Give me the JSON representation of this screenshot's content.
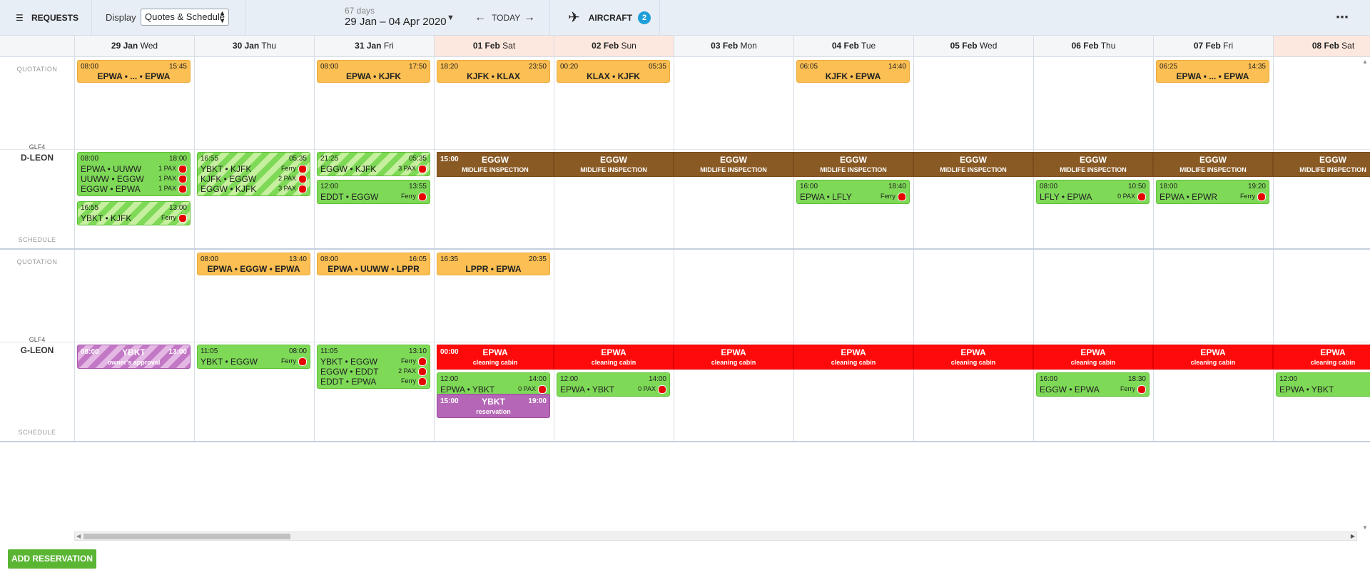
{
  "toolbar": {
    "requests_label": "REQUESTS",
    "display_label": "Display",
    "display_value": "Quotes & Schedule",
    "range_days": "67 days",
    "range_text": "29 Jan – 04 Apr 2020",
    "today_label": "TODAY",
    "aircraft_label": "AIRCRAFT",
    "aircraft_count": "2"
  },
  "days": [
    {
      "date": "29 Jan",
      "dow": "Wed",
      "weekend": false
    },
    {
      "date": "30 Jan",
      "dow": "Thu",
      "weekend": false
    },
    {
      "date": "31 Jan",
      "dow": "Fri",
      "weekend": false
    },
    {
      "date": "01 Feb",
      "dow": "Sat",
      "weekend": true
    },
    {
      "date": "02 Feb",
      "dow": "Sun",
      "weekend": true
    },
    {
      "date": "03 Feb",
      "dow": "Mon",
      "weekend": false
    },
    {
      "date": "04 Feb",
      "dow": "Tue",
      "weekend": false
    },
    {
      "date": "05 Feb",
      "dow": "Wed",
      "weekend": false
    },
    {
      "date": "06 Feb",
      "dow": "Thu",
      "weekend": false
    },
    {
      "date": "07 Feb",
      "dow": "Fri",
      "weekend": false
    },
    {
      "date": "08 Feb",
      "dow": "Sat",
      "weekend": true
    }
  ],
  "row_labels": {
    "quotation": "QUOTATION",
    "schedule": "SCHEDULE"
  },
  "aircraft": [
    {
      "type": "GLF4",
      "reg": "D-LEON",
      "quotes": [
        {
          "day": 0,
          "start": "08:00",
          "end": "15:45",
          "route": "EPWA • ... • EPWA"
        },
        {
          "day": 2,
          "start": "08:00",
          "end": "17:50",
          "route": "EPWA • KJFK"
        },
        {
          "day": 3,
          "start": "18:20",
          "end": "23:50",
          "route": "KJFK • KLAX"
        },
        {
          "day": 4,
          "start": "00:20",
          "end": "05:35",
          "route": "KLAX • KJFK"
        },
        {
          "day": 6,
          "start": "06:05",
          "end": "14:40",
          "route": "KJFK • EPWA"
        },
        {
          "day": 9,
          "start": "06:25",
          "end": "14:35",
          "route": "EPWA • ... • EPWA"
        }
      ],
      "flights": [
        {
          "day": 0,
          "slot": 0,
          "style": "s",
          "start": "08:00",
          "end": "18:00",
          "legs": [
            {
              "route": "EPWA • UUWW",
              "meta": "1 PAX"
            },
            {
              "route": "UUWW • EGGW",
              "meta": "1 PAX"
            },
            {
              "route": "EGGW • EPWA",
              "meta": "1 PAX"
            }
          ]
        },
        {
          "day": 0,
          "slot": 2,
          "style": "hatch",
          "start": "16:55",
          "end": "13:00",
          "legs": [
            {
              "route": "YBKT • KJFK",
              "meta": "Ferry"
            }
          ]
        },
        {
          "day": 1,
          "slot": 0,
          "style": "hatch",
          "start": "16:55",
          "end": "05:35",
          "legs": [
            {
              "route": "YBKT • KJFK",
              "meta": "Ferry"
            },
            {
              "route": "KJFK • EGGW",
              "meta": "2 PAX"
            },
            {
              "route": "EGGW • KJFK",
              "meta": "3 PAX"
            }
          ]
        },
        {
          "day": 2,
          "slot": 0,
          "style": "hatch",
          "start": "21:25",
          "end": "05:35",
          "legs": [
            {
              "route": "EGGW • KJFK",
              "meta": "3 PAX"
            }
          ]
        },
        {
          "day": 2,
          "slot": 1,
          "style": "s",
          "start": "12:00",
          "end": "13:55",
          "legs": [
            {
              "route": "EDDT • EGGW",
              "meta": "Ferry"
            }
          ]
        },
        {
          "day": 6,
          "slot": 1,
          "style": "s",
          "start": "16:00",
          "end": "18:40",
          "legs": [
            {
              "route": "EPWA • LFLY",
              "meta": "Ferry"
            }
          ]
        },
        {
          "day": 8,
          "slot": 1,
          "style": "s",
          "start": "08:00",
          "end": "10:50",
          "legs": [
            {
              "route": "LFLY • EPWA",
              "meta": "0 PAX"
            }
          ]
        },
        {
          "day": 9,
          "slot": 1,
          "style": "s",
          "start": "18:00",
          "end": "19:20",
          "legs": [
            {
              "route": "EPWA • EPWR",
              "meta": "Ferry"
            }
          ]
        }
      ],
      "blocks": [
        {
          "from": 3,
          "to": 10,
          "style": "brown",
          "start": "15:00",
          "title": "EGGW",
          "sub": "MIDLIFE INSPECTION"
        }
      ],
      "reservations": []
    },
    {
      "type": "GLF4",
      "reg": "G-LEON",
      "quotes": [
        {
          "day": 1,
          "start": "08:00",
          "end": "13:40",
          "route": "EPWA • EGGW • EPWA"
        },
        {
          "day": 2,
          "start": "08:00",
          "end": "16:05",
          "route": "EPWA • UUWW • LPPR"
        },
        {
          "day": 3,
          "start": "16:35",
          "end": "20:35",
          "route": "LPPR • EPWA"
        }
      ],
      "flights": [
        {
          "day": 1,
          "slot": 0,
          "style": "s",
          "start": "11:05",
          "end": "08:00",
          "legs": [
            {
              "route": "YBKT • EGGW",
              "meta": "Ferry"
            }
          ]
        },
        {
          "day": 2,
          "slot": 0,
          "style": "s",
          "start": "11:05",
          "end": "13:10",
          "legs": [
            {
              "route": "YBKT • EGGW",
              "meta": "Ferry"
            },
            {
              "route": "EGGW • EDDT",
              "meta": "2 PAX"
            },
            {
              "route": "EDDT • EPWA",
              "meta": "Ferry"
            }
          ]
        },
        {
          "day": 3,
          "slot": 1,
          "style": "s",
          "start": "12:00",
          "end": "14:00",
          "legs": [
            {
              "route": "EPWA • YBKT",
              "meta": "0 PAX"
            }
          ]
        },
        {
          "day": 4,
          "slot": 1,
          "style": "s",
          "start": "12:00",
          "end": "14:00",
          "legs": [
            {
              "route": "EPWA • YBKT",
              "meta": "0 PAX"
            }
          ]
        },
        {
          "day": 8,
          "slot": 1,
          "style": "s",
          "start": "16:00",
          "end": "18:30",
          "legs": [
            {
              "route": "EGGW • EPWA",
              "meta": "Ferry"
            }
          ]
        },
        {
          "day": 10,
          "slot": 1,
          "style": "s",
          "start": "12:00",
          "end": "",
          "legs": [
            {
              "route": "EPWA • YBKT",
              "meta": ""
            }
          ]
        }
      ],
      "blocks": [
        {
          "from": 3,
          "to": 10,
          "style": "red",
          "start": "00:00",
          "title": "EPWA",
          "sub": "cleaning cabin"
        }
      ],
      "reservations": [
        {
          "day": 0,
          "slot": 0,
          "style": "phatch",
          "start": "08:00",
          "end": "13:00",
          "title": "YBKT",
          "sub": "owner's approval"
        },
        {
          "day": 3,
          "slot": 2,
          "style": "purple",
          "start": "15:00",
          "end": "19:00",
          "title": "YBKT",
          "sub": "reservation"
        }
      ]
    }
  ],
  "add_button": "ADD RESERVATION"
}
